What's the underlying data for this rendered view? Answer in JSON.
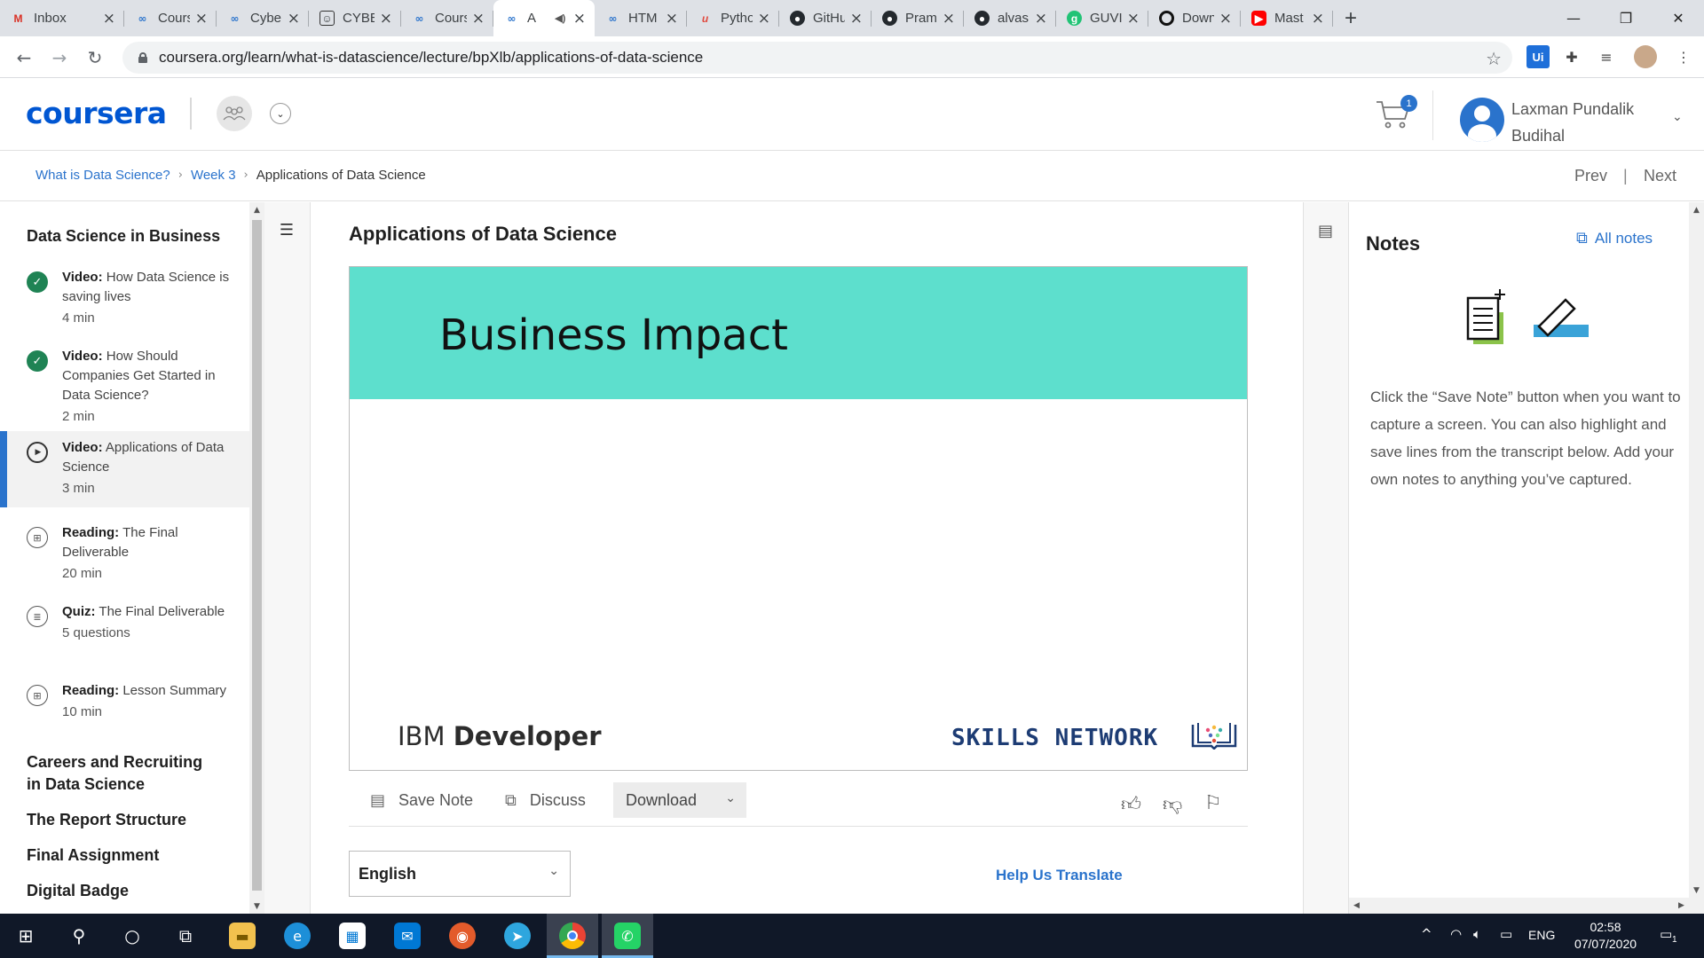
{
  "browser": {
    "tabs": [
      {
        "title": "Inbox",
        "icon": "gmail-icon",
        "active": false
      },
      {
        "title": "Cours",
        "icon": "coursera-icon",
        "active": false
      },
      {
        "title": "Cyber",
        "icon": "coursera-icon",
        "active": false
      },
      {
        "title": "CYBE",
        "icon": "cyber-icon",
        "active": false
      },
      {
        "title": "Cours",
        "icon": "coursera-icon",
        "active": false
      },
      {
        "title": "A",
        "icon": "coursera-icon",
        "active": true
      },
      {
        "title": "HTM",
        "icon": "coursera-icon",
        "active": false
      },
      {
        "title": "Pytho",
        "icon": "python-icon",
        "active": false
      },
      {
        "title": "GitHu",
        "icon": "github-icon",
        "active": false
      },
      {
        "title": "Pram",
        "icon": "github-icon",
        "active": false
      },
      {
        "title": "alvas",
        "icon": "github-icon",
        "active": false
      },
      {
        "title": "GUVI",
        "icon": "guvi-icon",
        "active": false
      },
      {
        "title": "Down",
        "icon": "ring-icon",
        "active": false
      },
      {
        "title": "Mast",
        "icon": "youtube-icon",
        "active": false
      }
    ],
    "url": "coursera.org/learn/what-is-datascience/lecture/bpXlb/applications-of-data-science",
    "ext_ui_label": "Ui"
  },
  "header": {
    "logo": "coursera",
    "cart_count": "1",
    "user_name": "Laxman Pundalik Budihal"
  },
  "breadcrumb": {
    "items": [
      "What is Data Science?",
      "Week 3"
    ],
    "current": "Applications of Data Science",
    "prev": "Prev",
    "separator": "|",
    "next": "Next"
  },
  "sidebar": {
    "week_title": "Data Science in Business",
    "lessons": [
      {
        "type": "Video:",
        "title": "How Data Science is saving lives",
        "duration": "4 min",
        "status": "done"
      },
      {
        "type": "Video:",
        "title": "How Should Companies Get Started in Data Science?",
        "duration": "2 min",
        "status": "done"
      },
      {
        "type": "Video:",
        "title": "Applications of Data Science",
        "duration": "3 min",
        "status": "current"
      },
      {
        "type": "Reading:",
        "title": "The Final Deliverable",
        "duration": "20 min",
        "status": "reading"
      },
      {
        "type": "Quiz:",
        "title": "The Final Deliverable",
        "duration": "5 questions",
        "status": "quiz"
      },
      {
        "type": "Reading:",
        "title": "Lesson Summary",
        "duration": "10 min",
        "status": "reading"
      }
    ],
    "modules": [
      "Careers and Recruiting in Data Science",
      "The Report Structure",
      "Final Assignment",
      "Digital Badge"
    ]
  },
  "lecture": {
    "title": "Applications of Data Science",
    "slide_title": "Business Impact",
    "brand_left_light": "IBM",
    "brand_left_bold": "Developer",
    "brand_right": "SKILLS NETWORK",
    "slide_band_color": "#5ddfcd"
  },
  "toolbar": {
    "save_note": "Save Note",
    "discuss": "Discuss",
    "download": "Download"
  },
  "language": {
    "selected": "English",
    "help_translate": "Help Us Translate"
  },
  "notes": {
    "title": "Notes",
    "all_notes": "All notes",
    "description": "Click the “Save Note” button when you want to capture a screen. You can also highlight and save lines from the transcript below. Add your own notes to anything you’ve captured."
  },
  "taskbar": {
    "time": "02:58",
    "date": "07/07/2020",
    "lang": "ENG",
    "notification_count": "1"
  },
  "colors": {
    "accent": "#2a73cc",
    "brand": "#0056d2",
    "complete": "#1f8354"
  }
}
